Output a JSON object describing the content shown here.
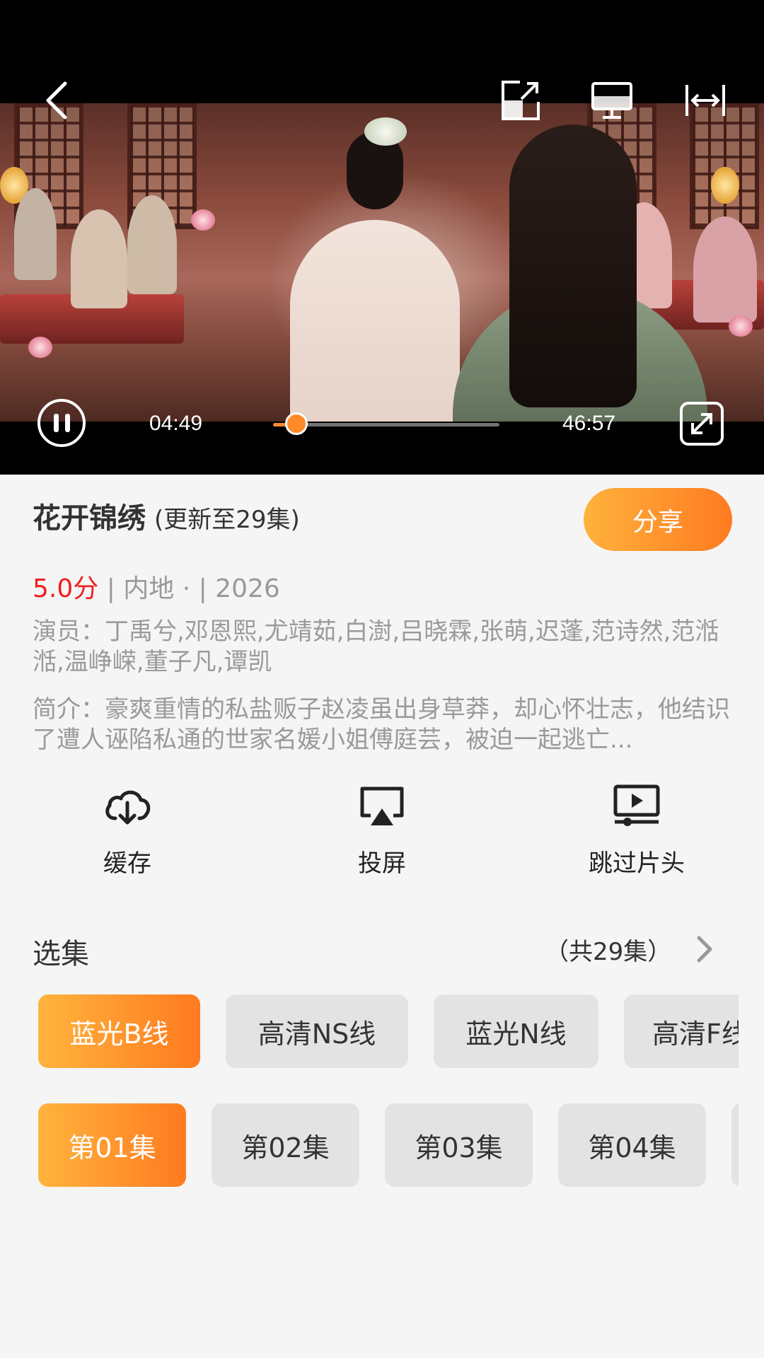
{
  "player": {
    "current_time": "04:49",
    "total_time": "46:57",
    "progress": 0.103
  },
  "info": {
    "title": "花开锦绣",
    "update_status": "(更新至29集)",
    "share_label": "分享",
    "score": "5.0分",
    "meta": " | 内地 · | 2026",
    "cast": "演员：丁禹兮,邓恩熙,尤靖茹,白澍,吕晓霖,张萌,迟蓬,范诗然,范湉湉,温峥嵘,董子凡,谭凯",
    "intro": "简介：豪爽重情的私盐贩子赵凌虽出身草莽，却心怀壮志，他结识了遭人诬陷私通的世家名媛小姐傅庭芸，被迫一起逃亡..."
  },
  "actions": [
    {
      "label": "缓存",
      "icon": "cloud-download-icon"
    },
    {
      "label": "投屏",
      "icon": "airplay-icon"
    },
    {
      "label": "跳过片头",
      "icon": "skip-intro-icon"
    }
  ],
  "episodes_section": {
    "title": "选集",
    "count": "（共29集）"
  },
  "sources": [
    "蓝光B线",
    "高清NS线",
    "蓝光N线",
    "高清F线"
  ],
  "episodes": [
    "第01集",
    "第02集",
    "第03集",
    "第04集"
  ],
  "colors": {
    "accent_start": "#ffb43e",
    "accent_end": "#ff7a1f",
    "score": "#f01e1e",
    "background": "#f5f5f5"
  }
}
